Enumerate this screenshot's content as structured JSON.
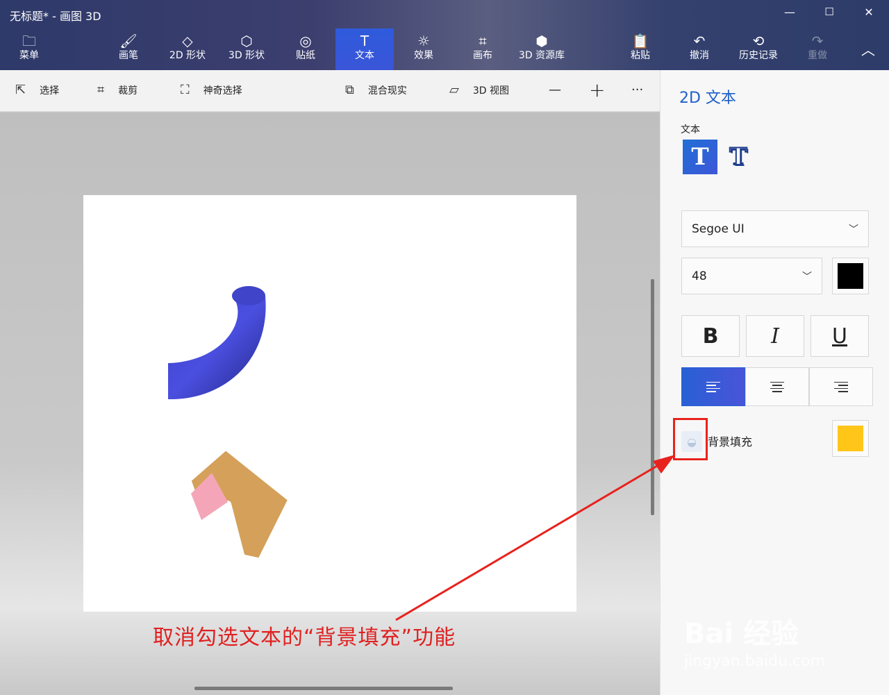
{
  "window": {
    "title": "无标题* - 画图 3D"
  },
  "window_controls": {
    "minimize": "—",
    "maximize": "☐",
    "close": "✕"
  },
  "ribbon": {
    "menu": "菜单",
    "brushes": "画笔",
    "shapes2d": "2D 形状",
    "shapes3d": "3D 形状",
    "stickers": "贴纸",
    "text": "文本",
    "effects": "效果",
    "canvas": "画布",
    "library3d": "3D 资源库",
    "paste": "粘贴",
    "undo": "撤消",
    "history": "历史记录",
    "redo": "重做"
  },
  "toolbar": {
    "select": "选择",
    "crop": "裁剪",
    "magic_select": "神奇选择",
    "mixed_reality": "混合现实",
    "view3d": "3D 视图",
    "zoom_out": "—",
    "zoom_in": "+",
    "more": "···"
  },
  "panel": {
    "title": "2D 文本",
    "text_section": "文本",
    "font_family": "Segoe UI",
    "font_size": "48",
    "text_color": "#000000",
    "bold": "B",
    "italic": "I",
    "underline": "U",
    "bg_fill_label": "背景填充",
    "bg_fill_checked": false,
    "bg_fill_color": "#ffc619"
  },
  "annotation": {
    "text": "取消勾选文本的“背景填充”功能"
  },
  "watermark": {
    "brand": "Bai 经验",
    "url": "jingyan.baidu.com"
  }
}
